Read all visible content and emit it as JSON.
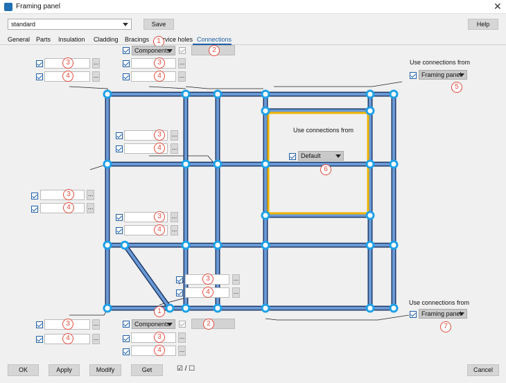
{
  "window": {
    "title": "Framing panel",
    "close_glyph": "✕"
  },
  "toolbar": {
    "preset": "standard",
    "save_label": "Save",
    "help_label": "Help"
  },
  "tabs": [
    "General",
    "Parts",
    "Insulation",
    "Cladding",
    "Bracings",
    "Service holes",
    "Connections"
  ],
  "active_tab": "Connections",
  "components_label": "Components",
  "use_connections_from": "Use connections from",
  "framing_panel_label": "Framing panel",
  "default_label": "Default",
  "ellipsis": "...",
  "markers": {
    "m1": "1",
    "m2": "2",
    "m3": "3",
    "m4": "4",
    "m5": "5",
    "m6": "6",
    "m7": "7"
  },
  "bottom": {
    "ok": "OK",
    "apply": "Apply",
    "modify": "Modify",
    "get": "Get",
    "toggle": "☑ / ☐",
    "cancel": "Cancel"
  },
  "colors": {
    "frame": "#4a78b8",
    "node": "#1ea0e8",
    "highlight": "#f0b400"
  }
}
